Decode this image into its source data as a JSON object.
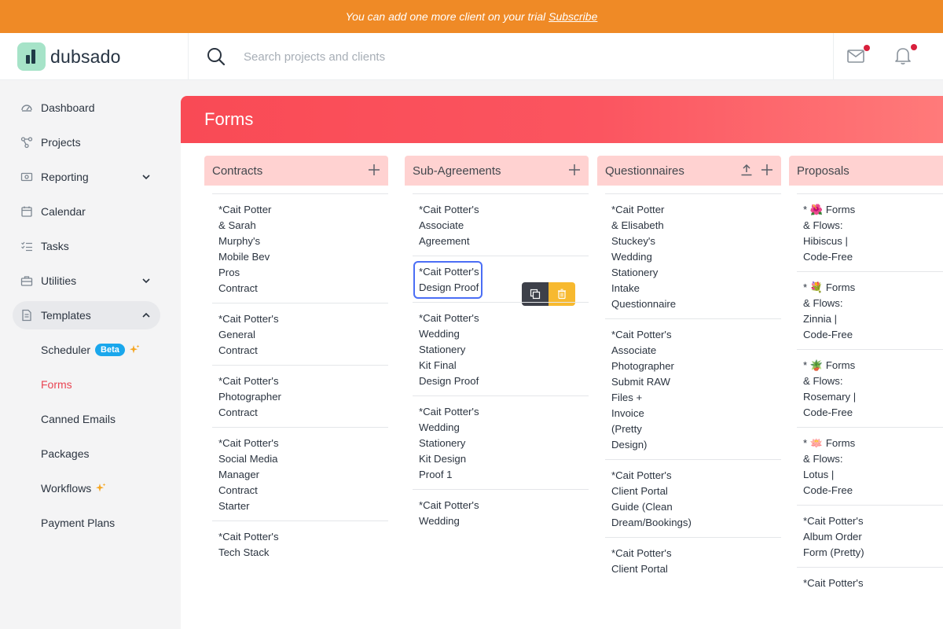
{
  "banner": {
    "message": "You can add one more client on your trial",
    "link": "Subscribe"
  },
  "brand": {
    "name": "dubsado"
  },
  "search": {
    "placeholder": "Search projects and clients"
  },
  "sidebar": {
    "items": [
      {
        "label": "Dashboard",
        "icon": "dashboard-icon"
      },
      {
        "label": "Projects",
        "icon": "projects-icon"
      },
      {
        "label": "Reporting",
        "icon": "reporting-icon"
      },
      {
        "label": "Calendar",
        "icon": "calendar-icon"
      },
      {
        "label": "Tasks",
        "icon": "tasks-icon"
      },
      {
        "label": "Utilities",
        "icon": "utilities-icon"
      },
      {
        "label": "Templates",
        "icon": "templates-icon"
      }
    ],
    "sub_items": [
      {
        "label": "Scheduler",
        "badge": "Beta"
      },
      {
        "label": "Forms"
      },
      {
        "label": "Canned Emails"
      },
      {
        "label": "Packages"
      },
      {
        "label": "Workflows"
      },
      {
        "label": "Payment Plans"
      }
    ]
  },
  "page": {
    "title": "Forms"
  },
  "columns": [
    {
      "title": "Contracts",
      "items": [
        "*Cait Potter & Sarah Murphy's Mobile Bev Pros Contract",
        "*Cait Potter's General Contract",
        "*Cait Potter's Photographer Contract",
        "*Cait Potter's Social Media Manager Contract Starter",
        "*Cait Potter's Tech Stack"
      ]
    },
    {
      "title": "Sub-Agreements",
      "items": [
        "*Cait Potter's Associate Agreement",
        "*Cait Potter's Design Proof",
        "*Cait Potter's Wedding Stationery Kit Final Design Proof",
        "*Cait Potter's Wedding Stationery Kit Design Proof 1",
        "*Cait Potter's Wedding"
      ]
    },
    {
      "title": "Questionnaires",
      "items": [
        "*Cait Potter & Elisabeth Stuckey's Wedding Stationery Intake Questionnaire",
        "*Cait Potter's Associate Photographer Submit RAW Files + Invoice (Pretty Design)",
        "*Cait Potter's Client Portal Guide (Clean Dream/Bookings)",
        "*Cait Potter's Client Portal"
      ]
    },
    {
      "title": "Proposals",
      "items": [
        "* 🌺 Forms & Flows: Hibiscus | Code-Free",
        "* 💐 Forms & Flows: Zinnia | Code-Free",
        "* 🪴 Forms & Flows: Rosemary | Code-Free",
        "* 🪷 Forms & Flows: Lotus | Code-Free",
        "*Cait Potter's Album Order Form (Pretty)",
        "*Cait Potter's"
      ]
    }
  ],
  "colors": {
    "banner": "#ef8a26",
    "header": "#f94a55",
    "column_header": "#ffd2d1",
    "active_link": "#e94553",
    "badge": "#1aa7ec",
    "delete_button": "#f7b92f"
  }
}
